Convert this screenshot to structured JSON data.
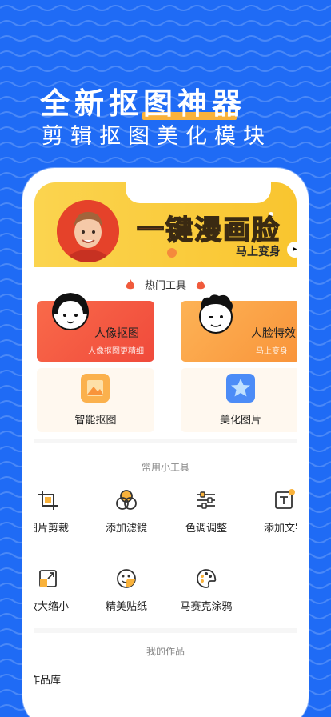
{
  "promo": {
    "headline": "全新抠图神器",
    "subline": "剪辑抠图美化模块"
  },
  "banner": {
    "title": "一键漫画脸",
    "subtitle": "马上变身"
  },
  "hot_tools": {
    "header": "热门工具",
    "cards": [
      {
        "title": "人像抠图",
        "subtitle": "人像抠图更精细"
      },
      {
        "title": "人脸特效",
        "subtitle": "马上变身"
      }
    ],
    "plain": [
      {
        "label": "智能抠图"
      },
      {
        "label": "美化图片"
      }
    ]
  },
  "common_tools": {
    "header": "常用小工具",
    "row1": [
      {
        "label": "图片剪裁",
        "icon": "crop-icon"
      },
      {
        "label": "添加滤镜",
        "icon": "filter-icon"
      },
      {
        "label": "色调调整",
        "icon": "sliders-icon"
      },
      {
        "label": "添加文字",
        "icon": "text-icon"
      }
    ],
    "row2": [
      {
        "label": "放大缩小",
        "icon": "resize-icon"
      },
      {
        "label": "精美贴纸",
        "icon": "sticker-icon"
      },
      {
        "label": "马赛克涂鸦",
        "icon": "palette-icon"
      }
    ]
  },
  "my_works": {
    "header": "我的作品",
    "item": "作品库"
  },
  "colors": {
    "background": "#1F6BF5",
    "accent": "#F9B23B",
    "card_red": "#F04A3B",
    "card_orange": "#F9943A"
  }
}
